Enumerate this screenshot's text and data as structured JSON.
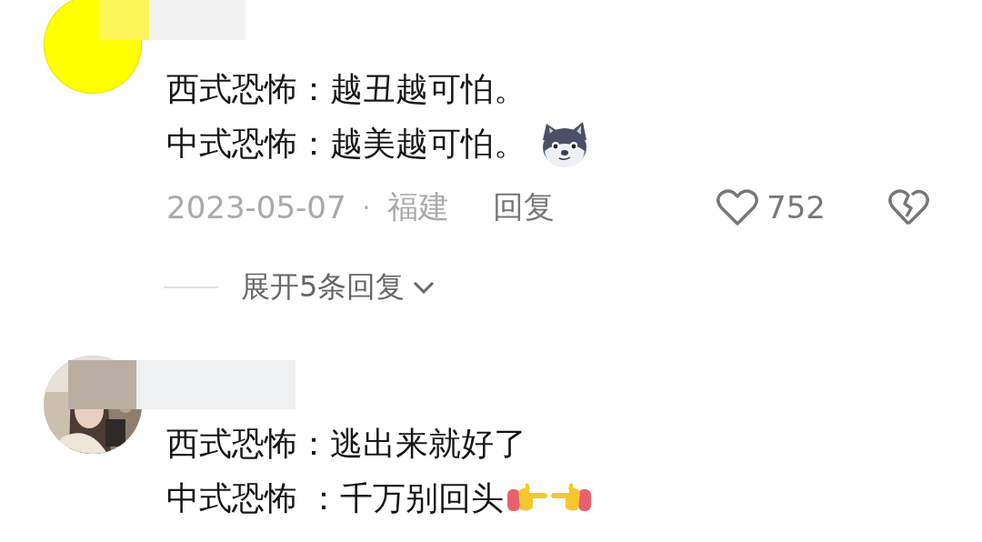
{
  "comments": [
    {
      "avatar": {
        "kind": "plain"
      },
      "name_redacted": true,
      "lines": [
        {
          "text": "西式恐怖：越丑越可怕。"
        },
        {
          "text": "中式恐怖：越美越可怕。",
          "kind": "dog"
        }
      ],
      "meta": {
        "date": "2023-05-07",
        "separator": "·",
        "location": "福建",
        "reply": "回复",
        "likes": "752"
      },
      "expand": {
        "label": "展开5条回复"
      }
    },
    {
      "name_redacted": true,
      "lines": [
        {
          "text": "西式恐怖：逃出来就好了"
        },
        {
          "text": "中式恐怖 ：千万别回头",
          "kind": "hands"
        }
      ]
    }
  ]
}
